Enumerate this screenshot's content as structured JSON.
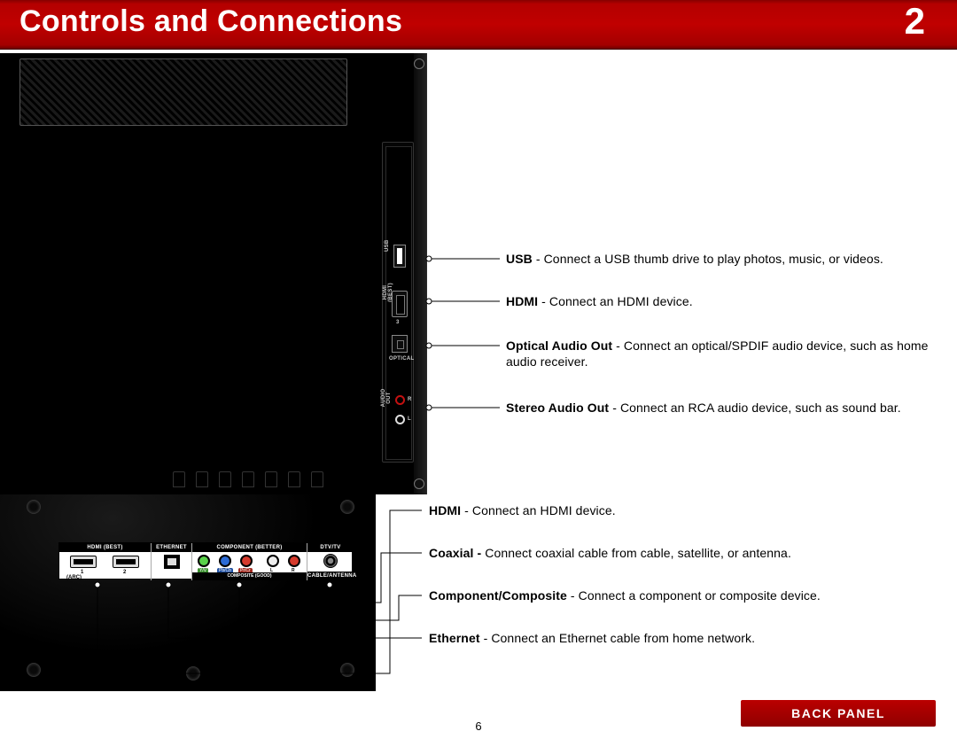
{
  "header": {
    "title": "Controls and Connections",
    "chapter": "2"
  },
  "side_ports": {
    "usb_label": "USB",
    "hdmi_label": "HDMI (BEST)",
    "hdmi_num": "3",
    "optical_label": "OPTICAL",
    "audio_out_label": "AUDIO OUT",
    "r": "R",
    "l": "L"
  },
  "bottom_ports": {
    "hdmi_head": "HDMI (BEST)",
    "hdmi1": "1",
    "hdmi2": "2",
    "arc": "(ARC)",
    "eth_head": "ETHERNET",
    "comp_head": "COMPONENT (BETTER)",
    "comp_sub": "COMPOSITE (GOOD)",
    "y": "Y/V",
    "pb": "Pb/Cb",
    "pr": "Pr/Cr",
    "audio_l": "L",
    "audio_r": "R",
    "dtv_head": "DTV/TV",
    "dtv_sub": "CABLE/ANTENNA"
  },
  "callouts": {
    "usb": {
      "bold": "USB",
      "text": " - Connect a USB thumb drive to play photos, music, or videos."
    },
    "hdmi_side": {
      "bold": "HDMI",
      "text": " - Connect an HDMI device."
    },
    "optical": {
      "bold": "Optical Audio Out",
      "text": " - Connect an optical/SPDIF audio device, such as home audio receiver."
    },
    "stereo": {
      "bold": "Stereo Audio Out",
      "text": " - Connect an RCA audio device, such as sound bar."
    },
    "hdmi_bot": {
      "bold": "HDMI",
      "text": " - Connect an HDMI device."
    },
    "coax": {
      "bold": "Coaxial - ",
      "text": "Connect coaxial cable from cable, satellite, or antenna."
    },
    "component": {
      "bold": "Component/Composite",
      "text": " - Connect a component or composite device."
    },
    "ethernet": {
      "bold": "Ethernet",
      "text": " - Connect an Ethernet cable from home network."
    }
  },
  "footer": {
    "back_panel": "BACK PANEL",
    "page_number": "6"
  }
}
